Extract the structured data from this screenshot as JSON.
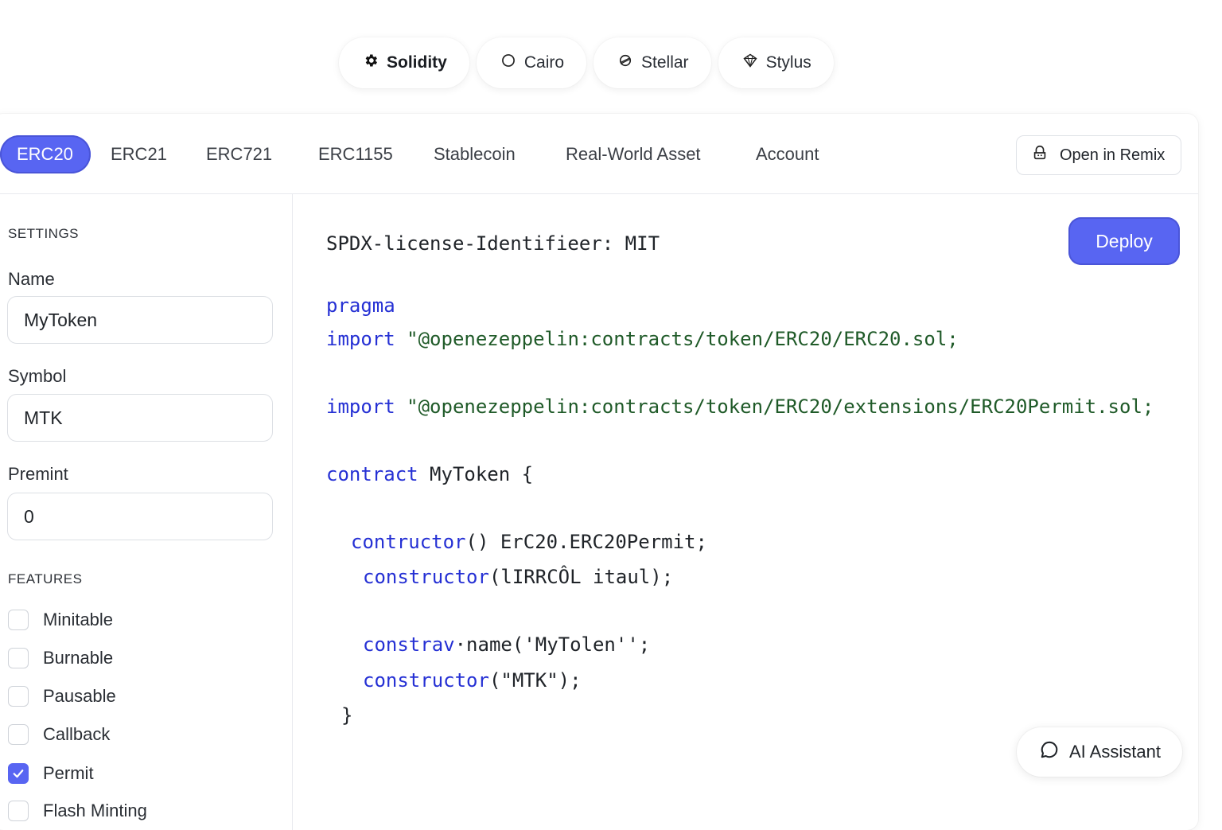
{
  "languages": [
    {
      "label": "Solidity",
      "icon": "gear-icon",
      "active": true
    },
    {
      "label": "Cairo",
      "icon": "circle-icon",
      "active": false
    },
    {
      "label": "Stellar",
      "icon": "stellar-icon",
      "active": false
    },
    {
      "label": "Stylus",
      "icon": "stylus-icon",
      "active": false
    }
  ],
  "tabs": [
    {
      "label": "ERC20",
      "active": true
    },
    {
      "label": "ERC21",
      "active": false
    },
    {
      "label": "ERC721",
      "active": false
    },
    {
      "label": "ERC1155",
      "active": false
    },
    {
      "label": "Stablecoin",
      "active": false
    },
    {
      "label": "Real-World Asset",
      "active": false
    },
    {
      "label": "Account",
      "active": false
    }
  ],
  "remix_button": {
    "label": "Open in Remix",
    "icon": "remix-icon"
  },
  "settings": {
    "title": "SETTINGS",
    "name_label": "Name",
    "name_value": "MyToken",
    "symbol_label": "Symbol",
    "symbol_value": "MTK",
    "premint_label": "Premint",
    "premint_value": "0"
  },
  "features": {
    "title": "FEATURES",
    "items": [
      {
        "label": "Minitable",
        "checked": false
      },
      {
        "label": "Burnable",
        "checked": false
      },
      {
        "label": "Pausable",
        "checked": false
      },
      {
        "label": "Callback",
        "checked": false
      },
      {
        "label": "Permit",
        "checked": true
      },
      {
        "label": "Flash Minting",
        "checked": false
      }
    ]
  },
  "code": {
    "license": "SPDX-license-Identifieer: MIT",
    "pragma": "pragma",
    "import_kw": "import",
    "import1_path": "\"@openezeppelin:contracts/token/ERC20/ERC20.sol;",
    "import2_path": "\"@openezeppelin:contracts/token/ERC20/extensions/ERC20Permit.sol;",
    "contract_kw": "contract",
    "contract_rest": " MyToken {",
    "ctor1_kw": "contructor",
    "ctor1_rest": "() ErC20.ERC20Permit;",
    "ctor2_kw": "constructor",
    "ctor2_rest": "(lIRRCÔL itaul);",
    "ctor3_kw": "constrav",
    "ctor3_rest": "·name('MyTolen'';",
    "ctor4_kw": "constructor",
    "ctor4_rest": "(\"MTK\");",
    "close": "}"
  },
  "deploy_button": {
    "label": "Deploy"
  },
  "ai_button": {
    "label": "AI Assistant",
    "icon": "chat-bubble-icon"
  },
  "colors": {
    "accent": "#5865f2",
    "keyword": "#2530d4",
    "string": "#1f5a28"
  }
}
